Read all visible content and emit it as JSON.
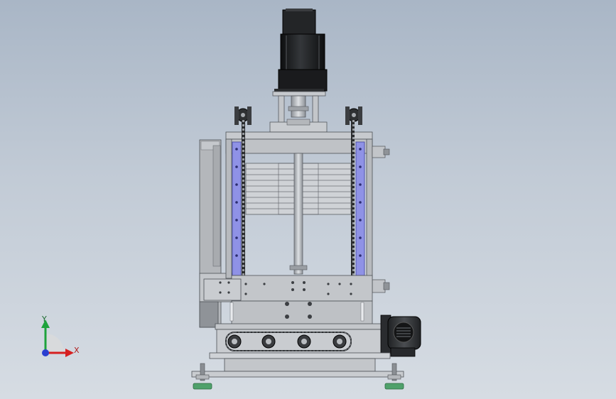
{
  "viewport": {
    "background_top": "#a9b6c6",
    "background_bottom": "#d6dce3"
  },
  "axis_triad": {
    "y_label": "Y",
    "x_label": "X",
    "y_color": "#1ea33c",
    "x_color": "#d62020",
    "z_color": "#2a3fd0"
  },
  "colors": {
    "frame_grey": "#b9bcc0",
    "plate_grey": "#c9ccd0",
    "dark_grey": "#6f7377",
    "motor_black": "#1b1c1e",
    "rail_purple": "#8f92e6",
    "foot_green": "#4fa16b"
  },
  "icons": {
    "motor": "servo-motor-icon",
    "gearmotor": "gearmotor-icon",
    "feet": "leveling-foot-icon"
  }
}
